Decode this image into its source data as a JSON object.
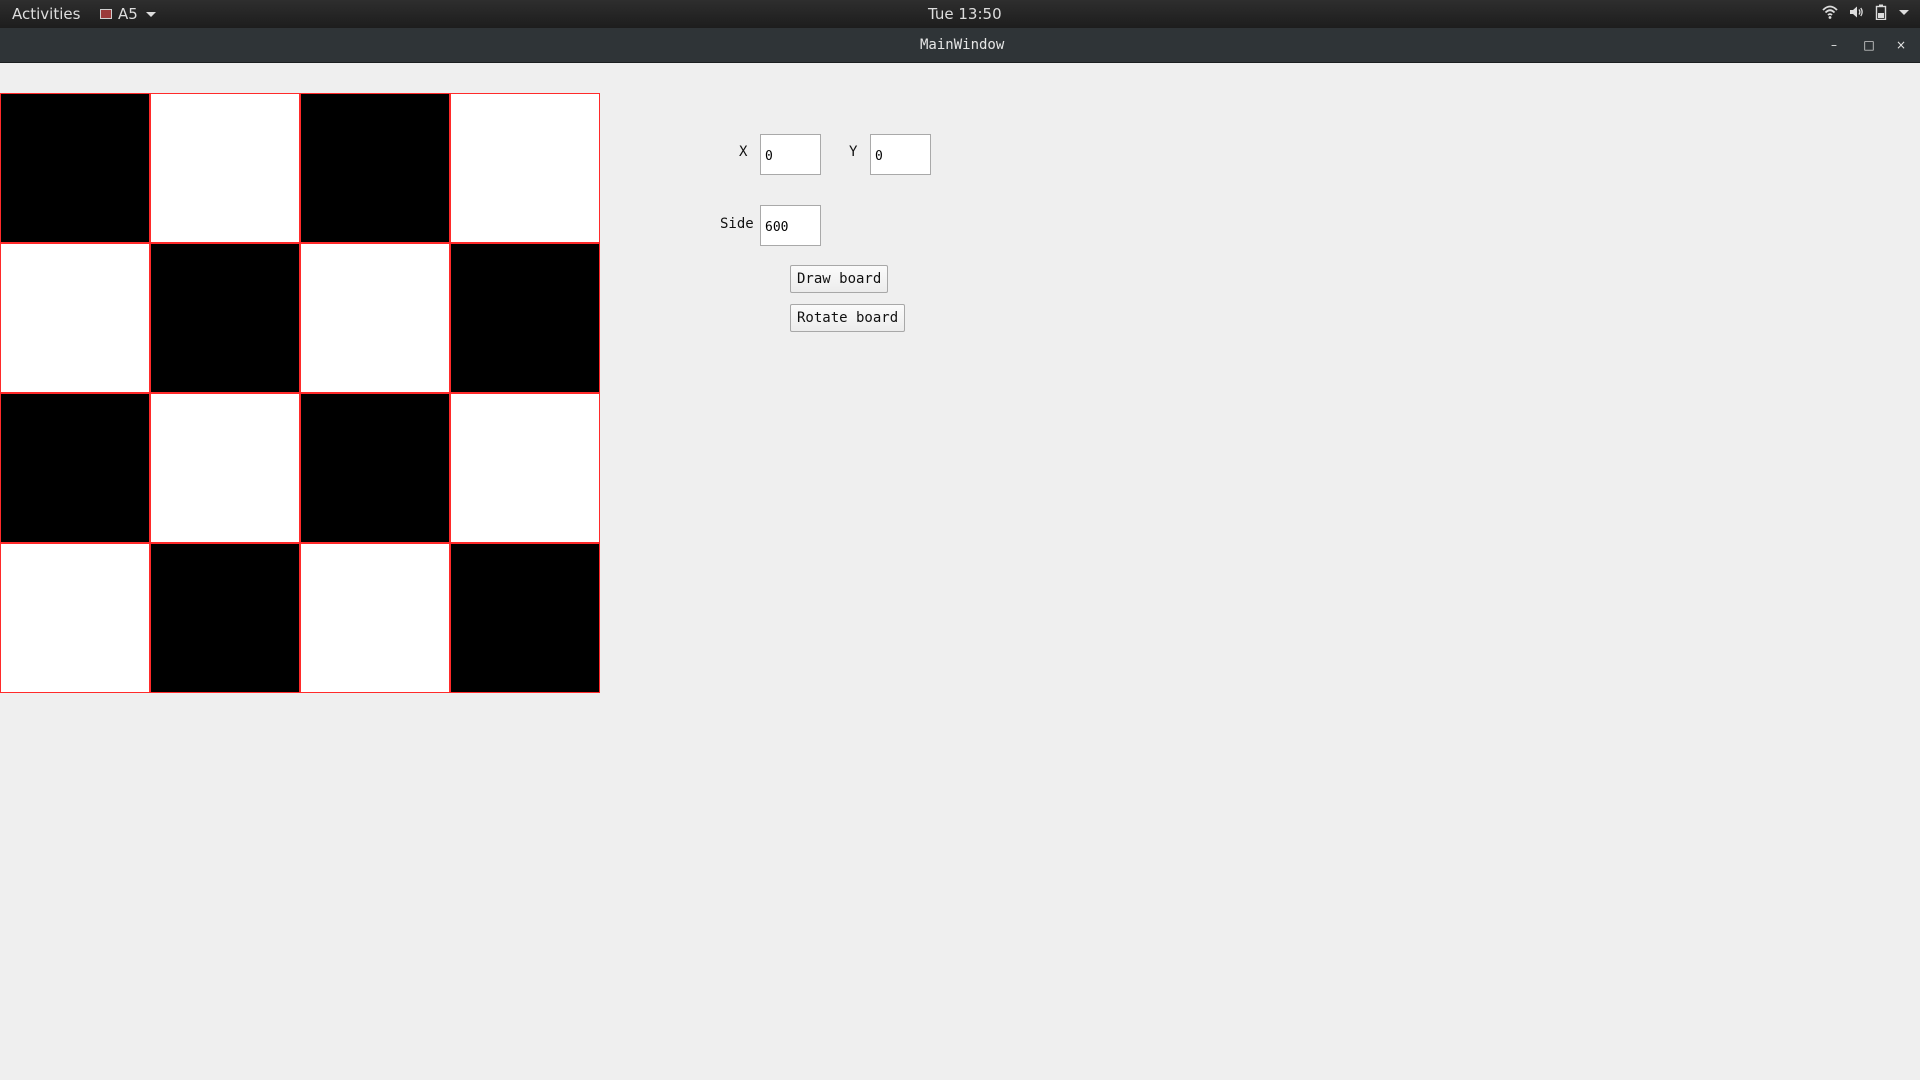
{
  "topbar": {
    "activities": "Activities",
    "app_name": "A5",
    "clock": "Tue 13:50",
    "tray_icons": [
      "wifi-icon",
      "volume-icon",
      "battery-icon",
      "chevron-down-icon"
    ]
  },
  "window": {
    "title": "MainWindow",
    "controls": {
      "minimize": "–",
      "maximize": "□",
      "close": "×"
    }
  },
  "board": {
    "rows": 4,
    "cols": 4,
    "dark_color": "#000000",
    "light_color": "#ffffff",
    "grid_color": "#ff2a2a",
    "first_cell_dark": true
  },
  "form": {
    "x_label": "X",
    "x_value": "0",
    "y_label": "Y",
    "y_value": "0",
    "side_label": "Side",
    "side_value": "600",
    "draw_button": "Draw board",
    "rotate_button": "Rotate board"
  }
}
